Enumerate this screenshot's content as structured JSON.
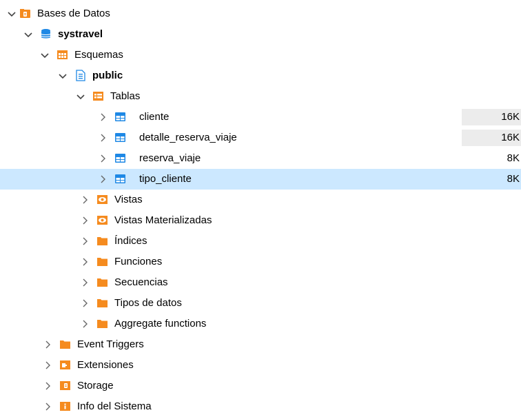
{
  "tree": {
    "root": {
      "label": "Bases de Datos",
      "icon": "database-folder-icon"
    },
    "database": {
      "label": "systravel",
      "icon": "database-icon"
    },
    "schemas": {
      "label": "Esquemas",
      "icon": "schemas-icon"
    },
    "schema_public": {
      "label": "public",
      "icon": "schema-icon"
    },
    "tables": {
      "label": "Tablas",
      "icon": "tables-folder-icon"
    },
    "table_items": [
      {
        "label": "cliente",
        "size": "16K",
        "icon": "table-icon"
      },
      {
        "label": "detalle_reserva_viaje",
        "size": "16K",
        "icon": "table-icon"
      },
      {
        "label": "reserva_viaje",
        "size": "8K",
        "icon": "table-icon"
      },
      {
        "label": "tipo_cliente",
        "size": "8K",
        "icon": "table-icon",
        "selected": true
      }
    ],
    "schema_children": [
      {
        "label": "Vistas",
        "icon": "view-icon"
      },
      {
        "label": "Vistas Materializadas",
        "icon": "view-icon"
      },
      {
        "label": "Índices",
        "icon": "folder-icon"
      },
      {
        "label": "Funciones",
        "icon": "folder-icon"
      },
      {
        "label": "Secuencias",
        "icon": "folder-icon"
      },
      {
        "label": "Tipos de datos",
        "icon": "folder-icon"
      },
      {
        "label": "Aggregate functions",
        "icon": "folder-icon"
      }
    ],
    "database_children": [
      {
        "label": "Event Triggers",
        "icon": "folder-icon"
      },
      {
        "label": "Extensiones",
        "icon": "extensions-icon"
      },
      {
        "label": "Storage",
        "icon": "storage-icon"
      },
      {
        "label": "Info del Sistema",
        "icon": "info-icon"
      }
    ]
  },
  "colors": {
    "selection": "#cce8ff",
    "folder_orange": "#f58b1f",
    "table_blue": "#1e88e5",
    "size_background": "#ececec"
  }
}
